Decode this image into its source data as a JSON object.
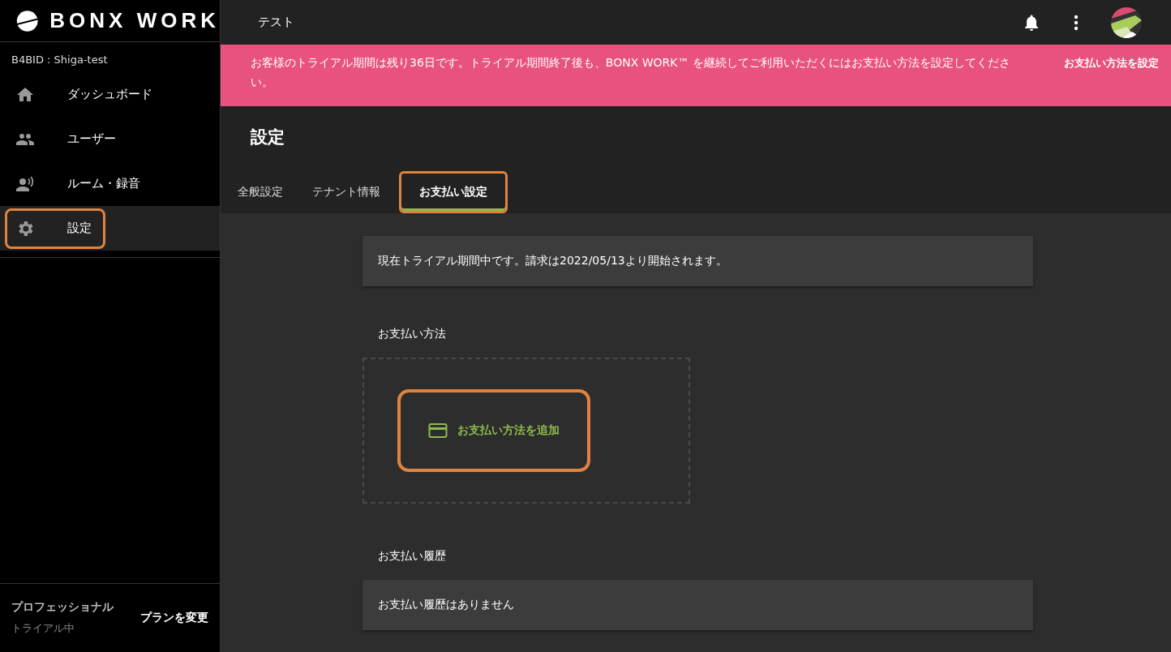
{
  "logo": {
    "text": "BONX WORK"
  },
  "sidebar": {
    "tenant": "B4BID : Shiga-test",
    "items": [
      {
        "label": "ダッシュボード",
        "selected": false,
        "highlighted": false
      },
      {
        "label": "ユーザー",
        "selected": false,
        "highlighted": false
      },
      {
        "label": "ルーム・録音",
        "selected": false,
        "highlighted": false
      },
      {
        "label": "設定",
        "selected": true,
        "highlighted": true
      }
    ],
    "plan": {
      "name": "プロフェッショナル",
      "status": "トライアル中",
      "action": "プランを変更"
    }
  },
  "topbar": {
    "title": "テスト"
  },
  "banner": {
    "message": "お客様のトライアル期間は残り36日です。トライアル期間終了後も、BONX WORK™ を継続してご利用いただくにはお支払い方法を設定してください。",
    "action": "お支払い方法を設定"
  },
  "page": {
    "title": "設定",
    "tabs": [
      {
        "label": "全般設定",
        "selected": false,
        "highlighted": false
      },
      {
        "label": "テナント情報",
        "selected": false,
        "highlighted": false
      },
      {
        "label": "お支払い設定",
        "selected": true,
        "highlighted": true
      }
    ]
  },
  "notice": "現在トライアル期間中です。請求は2022/05/13より開始されます。",
  "payment_method": {
    "heading": "お支払い方法",
    "add_button": "お支払い方法を追加",
    "highlighted": true
  },
  "payment_history": {
    "heading": "お支払い履歴",
    "empty_text": "お支払い履歴はありません"
  }
}
